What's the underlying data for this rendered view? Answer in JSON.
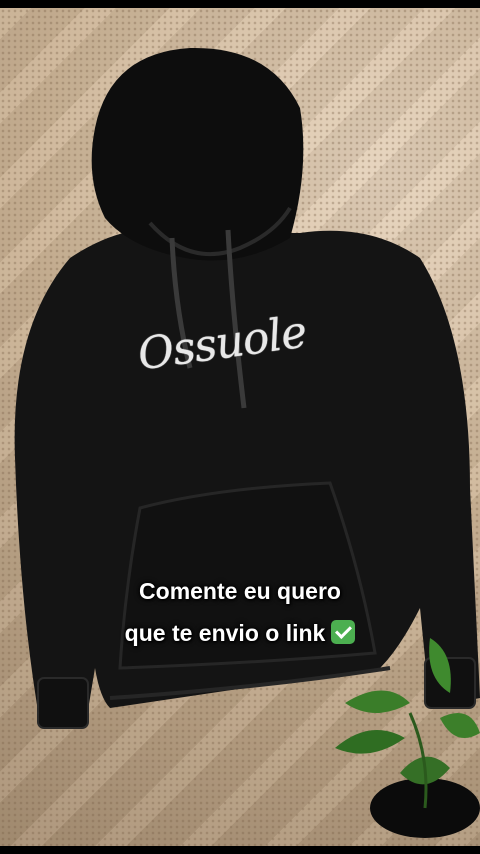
{
  "logo": {
    "text": "Ossuole"
  },
  "caption": {
    "line1": "Comente eu quero",
    "line2": "que te envio o link"
  },
  "icons": {
    "caption_end": "check-mark-icon"
  },
  "colors": {
    "hoodie": "#141414",
    "rug": "#cdb597",
    "check": "#4caf50",
    "caption": "#ffffff"
  }
}
